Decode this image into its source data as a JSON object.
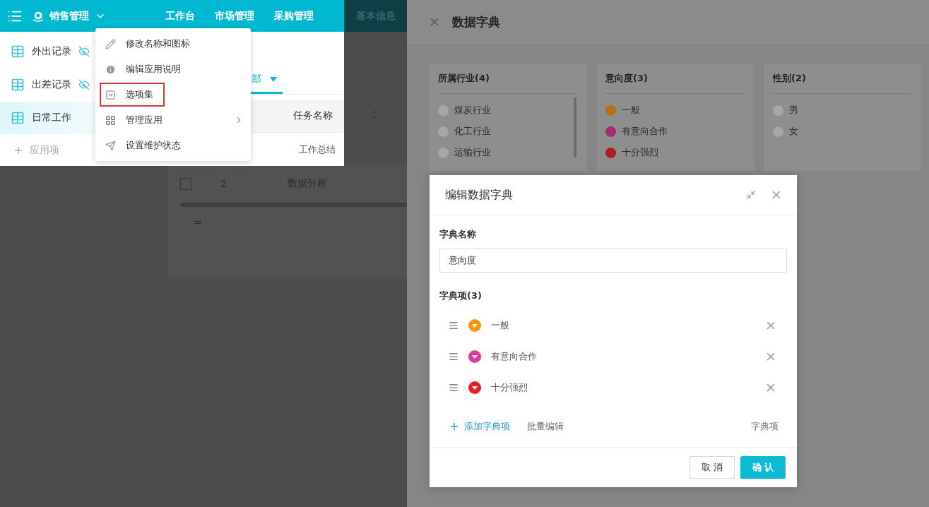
{
  "topbar": {
    "app_name": "销售管理",
    "nav": [
      {
        "label": "工作台",
        "dimmed": false
      },
      {
        "label": "市场管理",
        "dimmed": false
      },
      {
        "label": "采购管理",
        "dimmed": false
      },
      {
        "label": "基本信息",
        "dimmed": true
      }
    ]
  },
  "sidebar": {
    "items": [
      {
        "label": "外出记录",
        "hidden": true,
        "selected": false
      },
      {
        "label": "出差记录",
        "hidden": true,
        "selected": false
      },
      {
        "label": "日常工作",
        "hidden": false,
        "selected": true
      }
    ],
    "add_label": "应用项"
  },
  "content": {
    "tab_label": "部",
    "column": "任务名称",
    "visible_task": "工作总结",
    "dim_rows": [
      {
        "number": "2",
        "task": "数据分析",
        "checked": false
      }
    ],
    "footer_mark": "="
  },
  "app_menu": [
    {
      "label": "修改名称和图标",
      "kind": "edit",
      "highlighted": false,
      "submenu": false
    },
    {
      "label": "编辑应用说明",
      "kind": "info",
      "highlighted": false,
      "submenu": false
    },
    {
      "label": "选项集",
      "kind": "options",
      "highlighted": true,
      "submenu": false
    },
    {
      "label": "管理应用",
      "kind": "manage",
      "highlighted": false,
      "submenu": true
    },
    {
      "label": "设置维护状态",
      "kind": "maintain",
      "highlighted": false,
      "submenu": false
    }
  ],
  "drawer": {
    "title": "数据字典",
    "cards": [
      {
        "title": "所属行业(4)",
        "scrollable": true,
        "items": [
          {
            "label": "煤炭行业",
            "color": "#a6a6a6"
          },
          {
            "label": "化工行业",
            "color": "#a6a6a6"
          },
          {
            "label": "运输行业",
            "color": "#a6a6a6"
          }
        ]
      },
      {
        "title": "意向度(3)",
        "scrollable": false,
        "items": [
          {
            "label": "一般",
            "color": "#b8720c"
          },
          {
            "label": "有意向合作",
            "color": "#a52c72"
          },
          {
            "label": "十分强烈",
            "color": "#ae1c1e"
          }
        ]
      },
      {
        "title": "性别(2)",
        "scrollable": false,
        "items": [
          {
            "label": "男",
            "color": "#a6a6a6"
          },
          {
            "label": "女",
            "color": "#a6a6a6"
          }
        ]
      }
    ]
  },
  "modal": {
    "title": "编辑数据字典",
    "name_label": "字典名称",
    "name_value": "意向度",
    "items_label": "字典项(3)",
    "items": [
      {
        "label": "一般",
        "color": "#f7960f"
      },
      {
        "label": "有意向合作",
        "color": "#e23a9a"
      },
      {
        "label": "十分强烈",
        "color": "#ea1d25"
      }
    ],
    "add_label": "添加字典项",
    "batch_label": "批量编辑",
    "right_label": "字典项",
    "cancel": "取 消",
    "confirm": "确 认"
  }
}
